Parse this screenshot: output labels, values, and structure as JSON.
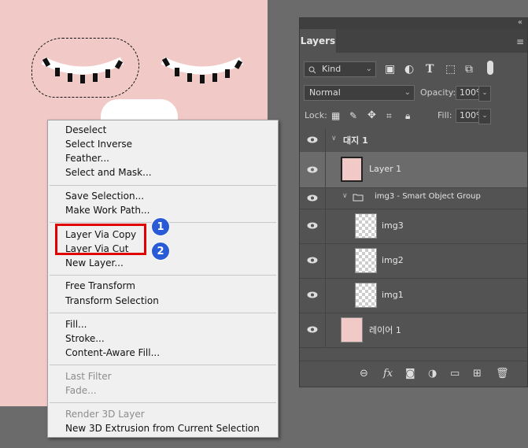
{
  "panel": {
    "tab_label": "Layers",
    "filter": {
      "value": "Kind"
    },
    "blend_mode": {
      "value": "Normal"
    },
    "opacity": {
      "label": "Opacity:",
      "value": "100%"
    },
    "lock": {
      "label": "Lock:"
    },
    "fill": {
      "label": "Fill:",
      "value": "100%"
    },
    "layers": [
      {
        "name": "대지 1",
        "type": "artboard"
      },
      {
        "name": "Layer 1",
        "type": "layer",
        "selected": true
      },
      {
        "name": "img3 - Smart Object Group",
        "type": "group"
      },
      {
        "name": "img3",
        "type": "layer"
      },
      {
        "name": "img2",
        "type": "layer"
      },
      {
        "name": "img1",
        "type": "layer"
      },
      {
        "name": "레이어 1",
        "type": "layer"
      }
    ],
    "footer_icons": [
      "link-icon",
      "fx-icon",
      "mask-icon",
      "adjustment-icon",
      "folder-icon",
      "new-layer-icon",
      "trash-icon"
    ]
  },
  "context_menu": {
    "items": [
      {
        "label": "Deselect",
        "enabled": true
      },
      {
        "label": "Select Inverse",
        "enabled": true
      },
      {
        "label": "Feather...",
        "enabled": true
      },
      {
        "label": "Select and Mask...",
        "enabled": true
      },
      {
        "label": "Save Selection...",
        "enabled": true
      },
      {
        "label": "Make Work Path...",
        "enabled": true
      },
      {
        "label": "Layer Via Copy",
        "enabled": true
      },
      {
        "label": "Layer Via Cut",
        "enabled": true
      },
      {
        "label": "New Layer...",
        "enabled": true
      },
      {
        "label": "Free Transform",
        "enabled": true
      },
      {
        "label": "Transform Selection",
        "enabled": true
      },
      {
        "label": "Fill...",
        "enabled": true
      },
      {
        "label": "Stroke...",
        "enabled": true
      },
      {
        "label": "Content-Aware Fill...",
        "enabled": true
      },
      {
        "label": "Last Filter",
        "enabled": false
      },
      {
        "label": "Fade...",
        "enabled": false
      },
      {
        "label": "Render 3D Layer",
        "enabled": false
      },
      {
        "label": "New 3D Extrusion from Current Selection",
        "enabled": true
      }
    ]
  },
  "annotations": {
    "badge1": "1",
    "badge2": "2"
  },
  "colors": {
    "canvas": "#f1cac7",
    "highlight": "#e00000",
    "badge": "#2a5bd7"
  }
}
